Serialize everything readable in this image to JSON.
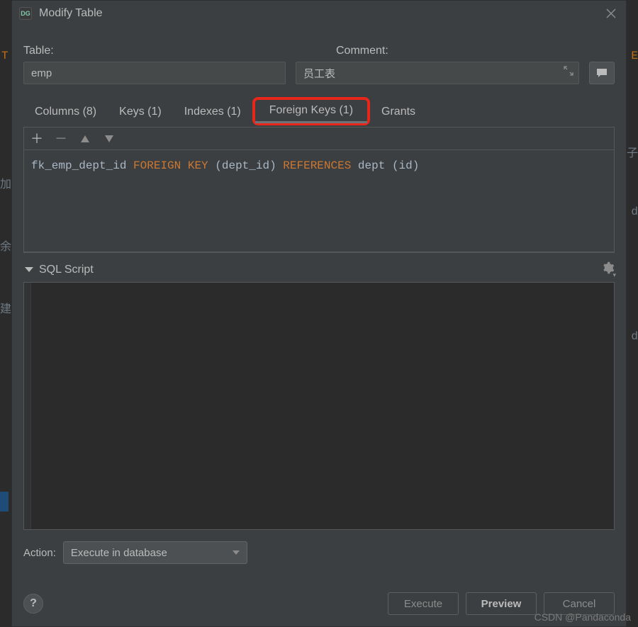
{
  "dialog": {
    "title": "Modify Table",
    "icon_label": "DG"
  },
  "fields": {
    "table_label": "Table:",
    "table_value": "emp",
    "comment_label": "Comment:",
    "comment_value": "员工表"
  },
  "tabs": [
    {
      "label": "Columns (8)",
      "key": "columns",
      "active": false
    },
    {
      "label": "Keys (1)",
      "key": "keys",
      "active": false
    },
    {
      "label": "Indexes (1)",
      "key": "indexes",
      "active": false
    },
    {
      "label": "Foreign Keys (1)",
      "key": "foreign_keys",
      "active": true,
      "highlight": true
    },
    {
      "label": "Grants",
      "key": "grants",
      "active": false
    }
  ],
  "fk_definition": {
    "name": "fk_emp_dept_id",
    "kw_foreign_key": "FOREIGN KEY",
    "cols": "(dept_id)",
    "kw_references": "REFERENCES",
    "ref_table": "dept",
    "ref_cols": "(id)"
  },
  "sql_section": {
    "title": "SQL Script"
  },
  "action": {
    "label": "Action:",
    "selected": "Execute in database"
  },
  "buttons": {
    "execute": "Execute",
    "preview": "Preview",
    "cancel": "Cancel",
    "help": "?"
  },
  "watermark": "CSDN @Pandaconda",
  "bg_text": {
    "t_left": "T",
    "e_right": "E",
    "zi_right": "子",
    "jia": "加",
    "yu": "余",
    "jian": "建",
    "d1": "d",
    "d2": "d"
  }
}
